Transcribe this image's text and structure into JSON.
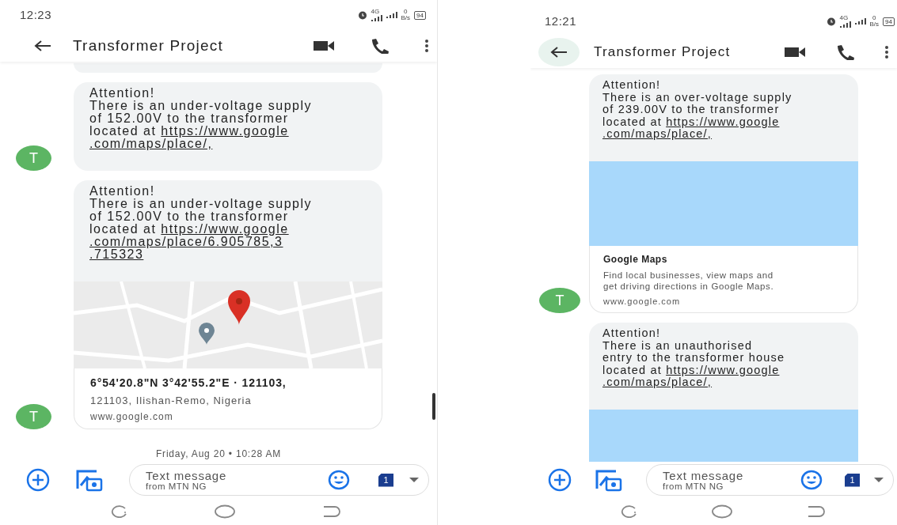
{
  "phones": [
    {
      "status_bar": {
        "time": "12:23",
        "network": "4G",
        "net_speed_value": "0",
        "net_speed_unit": "B/s",
        "battery": "94"
      },
      "header": {
        "title": "Transformer Project",
        "back_highlighted": false
      },
      "scrollbar": true,
      "messages": [
        {
          "kind": "stub"
        },
        {
          "kind": "bubble",
          "avatar": "T",
          "lines": [
            "Attention!",
            "There is an under-voltage supply",
            "of 152.00V to the transformer",
            "located at"
          ],
          "link_lines": [
            "https://www.google",
            ".com/maps/place/,"
          ]
        },
        {
          "kind": "bubble",
          "avatar": "T",
          "lines": [
            "Attention!",
            "There is an under-voltage supply",
            "of 152.00V to the transformer",
            "located at"
          ],
          "link_lines": [
            "https://www.google",
            ".com/maps/place/6.905785,3",
            ".715323"
          ],
          "preview": {
            "kind": "map",
            "title": "6°54'20.8\"N 3°42'55.2\"E · 121103,",
            "description_lines": [
              "121103, Ilishan-Remo, Nigeria"
            ],
            "domain": "www.google.com"
          }
        },
        {
          "kind": "date",
          "text": "Friday, Aug 20 • 10:28 AM"
        }
      ],
      "composer": {
        "placeholder": "Text message",
        "sim_label": "from MTN NG",
        "sim_number": "1"
      }
    },
    {
      "status_bar": {
        "time": "12:21",
        "network": "4G",
        "net_speed_value": "0",
        "net_speed_unit": "B/s",
        "battery": "94"
      },
      "header": {
        "title": "Transformer Project",
        "back_highlighted": true
      },
      "scrollbar": false,
      "messages": [
        {
          "kind": "bubble",
          "avatar": "T",
          "lines": [
            "Attention!",
            "There is an over-voltage supply",
            "of  239.00V to the transformer",
            "located at"
          ],
          "link_lines": [
            "https://www.google",
            ".com/maps/place/,"
          ],
          "preview": {
            "kind": "blank",
            "title": "Google Maps",
            "description_lines": [
              "Find local businesses, view maps and",
              "get driving directions in Google Maps."
            ],
            "domain": "www.google.com"
          }
        },
        {
          "kind": "bubble",
          "lines": [
            "Attention!",
            "There is an unauthorised",
            "entry to the transformer house",
            "located at"
          ],
          "link_lines": [
            "https://www.google",
            ".com/maps/place/,"
          ],
          "preview": {
            "kind": "blank"
          }
        }
      ],
      "composer": {
        "placeholder": "Text message",
        "sim_label": "from MTN NG",
        "sim_number": "1"
      }
    }
  ]
}
